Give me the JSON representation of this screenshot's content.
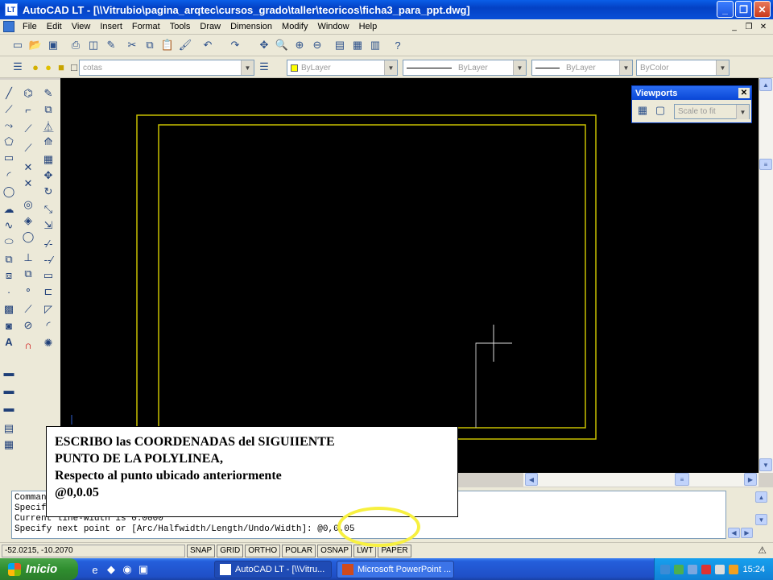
{
  "window": {
    "app_icon": "LT",
    "title": "AutoCAD LT - [\\\\Vitrubio\\pagina_arqtec\\cursos_grado\\taller\\teoricos\\ficha3_para_ppt.dwg]"
  },
  "menu": {
    "items": [
      "File",
      "Edit",
      "View",
      "Insert",
      "Format",
      "Tools",
      "Draw",
      "Dimension",
      "Modify",
      "Window",
      "Help"
    ]
  },
  "layers_toolbar": {
    "layer_name": "cotas",
    "color": "ByLayer",
    "linetype": "ByLayer",
    "lineweight": "ByLayer",
    "plotstyle": "ByColor"
  },
  "viewports_toolbar": {
    "title": "Viewports",
    "scale": "Scale to fit"
  },
  "command_window": {
    "lines": [
      "Command:",
      "Specify start point:",
      "Current line-width is 0.0000",
      "Specify next point or [Arc/Halfwidth/Length/Undo/Width]: @0,0.05"
    ]
  },
  "status": {
    "coords": "-52.0215, -10.2070",
    "toggles": [
      "SNAP",
      "GRID",
      "ORTHO",
      "POLAR",
      "OSNAP",
      "LWT",
      "PAPER"
    ]
  },
  "callout": {
    "line1": "ESCRIBO las COORDENADAS  del SIGUIIENTE",
    "line2": "PUNTO DE LA POLYLINEA,",
    "line3": "Respecto  al punto ubicado anteriormente",
    "line4": "@0,0.05"
  },
  "taskbar": {
    "start": "Inicio",
    "tasks": [
      "AutoCAD LT - [\\\\Vitru...",
      "Microsoft PowerPoint ..."
    ],
    "clock": "15:24"
  },
  "colors": {
    "drawing_lines": "#c8c000",
    "canvas": "#000000",
    "highlight_ring": "#f7f040"
  }
}
